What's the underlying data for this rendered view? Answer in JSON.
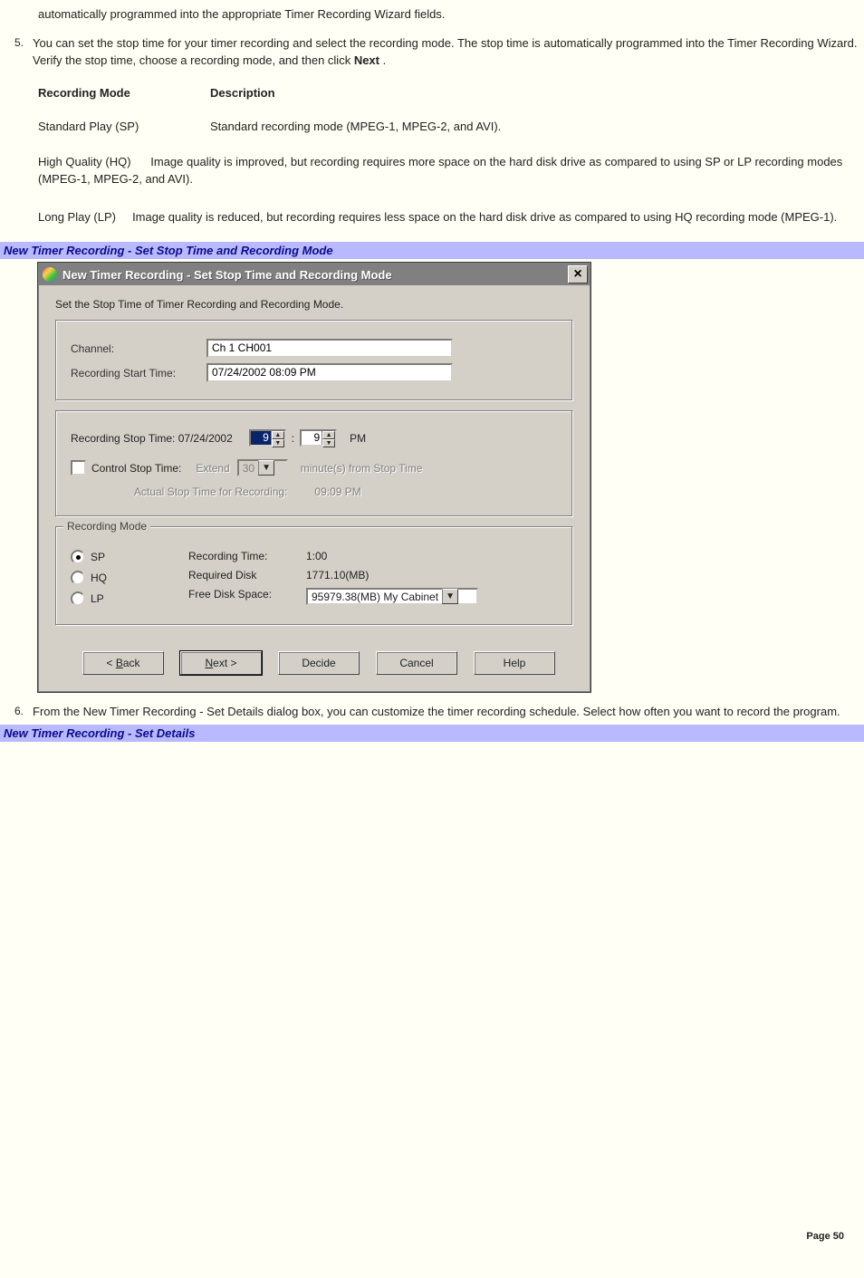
{
  "intro_line": "automatically programmed into the appropriate Timer Recording Wizard fields.",
  "step5": {
    "num": "5.",
    "text_a": "You can set the stop time for your timer recording and select the recording mode. The stop time is automatically programmed into the Timer Recording Wizard. Verify the stop time, choose a recording mode, and then click ",
    "bold": "Next",
    "text_b": " ."
  },
  "table": {
    "h1": "Recording Mode",
    "h2": "Description",
    "r1c1": "Standard Play (SP)",
    "r1c2": "Standard recording mode (MPEG-1, MPEG-2, and AVI).",
    "r2c1": "High Quality (HQ)",
    "r2c2": "Image quality is improved, but recording requires more space on the hard disk drive as compared to using SP or LP recording modes (MPEG-1, MPEG-2, and AVI).",
    "r3c1": "Long Play (LP)",
    "r3c2": "Image quality is reduced, but recording requires less space on the hard disk drive as compared to using HQ recording mode (MPEG-1)."
  },
  "caption1": "New Timer Recording - Set Stop Time and Recording Mode",
  "dialog": {
    "title": "New Timer Recording - Set Stop Time and Recording Mode",
    "subtitle": "Set the Stop Time of Timer Recording and Recording Mode.",
    "channel_label": "Channel:",
    "channel_value": "Ch 1 CH001",
    "start_label": "Recording Start Time:",
    "start_value": "07/24/2002 08:09 PM",
    "stop_label": "Recording Stop Time: 07/24/2002",
    "stop_hour": "9",
    "stop_colon": ":",
    "stop_min": "9",
    "stop_ampm": "PM",
    "ctrl_stop_label": "Control Stop Time:",
    "extend_label": "Extend",
    "extend_value": "30",
    "extend_suffix": "minute(s) from Stop Time",
    "actual_label": "Actual Stop Time for Recording:",
    "actual_value": "09:09 PM",
    "rm_legend": "Recording Mode",
    "rm_sp": "SP",
    "rm_hq": "HQ",
    "rm_lp": "LP",
    "rectime_label": "Recording Time:",
    "rectime_value": "1:00",
    "reqdisk_label": "Required Disk",
    "reqdisk_value": "1771.10(MB)",
    "freedisk_label": "Free Disk Space:",
    "freedisk_value": "95979.38(MB) My Cabinet",
    "btn_back": "< Back",
    "btn_next_pre": "N",
    "btn_next_post": "ext >",
    "btn_decide": "Decide",
    "btn_cancel": "Cancel",
    "btn_help": "Help"
  },
  "step6": {
    "num": "6.",
    "text": "From the New Timer Recording - Set Details dialog box, you can customize the timer recording schedule. Select how often you want to record the program."
  },
  "caption2": "New Timer Recording - Set Details",
  "page_footer": "Page 50"
}
